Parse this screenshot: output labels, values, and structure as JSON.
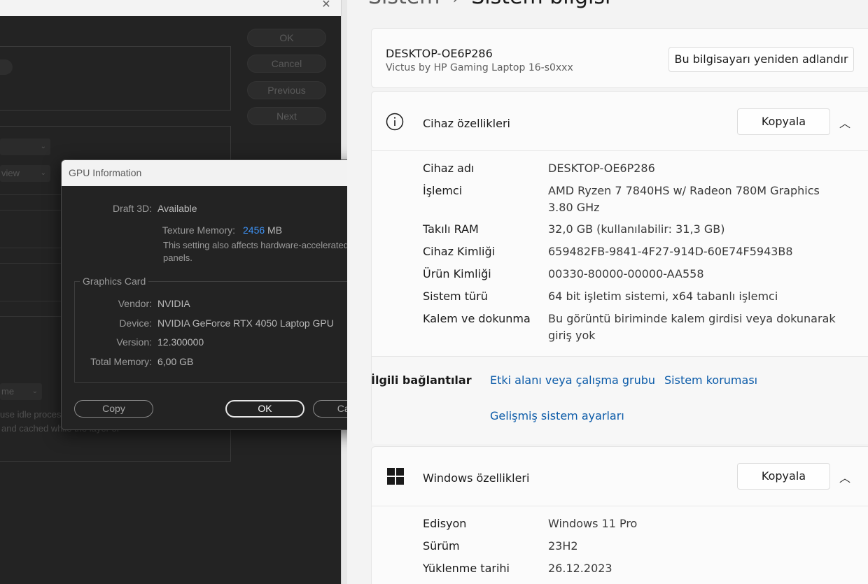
{
  "left_app": {
    "buttons": [
      {
        "label": "OK"
      },
      {
        "label": "Cancel"
      },
      {
        "label": "Previous"
      },
      {
        "label": "Next"
      }
    ],
    "partial_texts": {
      "select_view": "view",
      "select_name": "me",
      "idle_line1": "use idle proces",
      "idle_line2": "and cached while the layer or"
    }
  },
  "gpu_dialog": {
    "title": "GPU Information",
    "draft3d_label": "Draft 3D:",
    "draft3d_value": "Available",
    "texture_label": "Texture Memory:",
    "texture_value": "2456",
    "texture_unit": "MB",
    "note": "This setting also affects hardware-accelerated panels.",
    "graphics_card": {
      "legend": "Graphics Card",
      "vendor_label": "Vendor:",
      "vendor_value": "NVIDIA",
      "device_label": "Device:",
      "device_value": "NVIDIA GeForce RTX 4050 Laptop GPU",
      "version_label": "Version:",
      "version_value": "12.300000",
      "total_label": "Total Memory:",
      "total_value": "6,00 GB"
    },
    "buttons": {
      "copy": "Copy",
      "ok": "OK",
      "cancel": "Cancel"
    }
  },
  "settings": {
    "breadcrumb": {
      "parent": "Sistem",
      "separator": "›",
      "current": "Sistem bilgisi"
    },
    "device": {
      "name": "DESKTOP-OE6P286",
      "model": "Victus by HP Gaming Laptop 16-s0xxx",
      "rename_button": "Bu bilgisayarı yeniden adlandır"
    },
    "device_specs": {
      "title": "Cihaz özellikleri",
      "copy_button": "Kopyala",
      "rows": [
        {
          "label": "Cihaz adı",
          "value": "DESKTOP-OE6P286"
        },
        {
          "label": "İşlemci",
          "value": "AMD Ryzen 7 7840HS w/ Radeon 780M Graphics 3.80 GHz"
        },
        {
          "label": "Takılı RAM",
          "value": "32,0 GB (kullanılabilir: 31,3 GB)"
        },
        {
          "label": "Cihaz Kimliği",
          "value": "659482FB-9841-4F27-914D-60E74F5943B8"
        },
        {
          "label": "Ürün Kimliği",
          "value": "00330-80000-00000-AA558"
        },
        {
          "label": "Sistem türü",
          "value": "64 bit işletim sistemi, x64 tabanlı işlemci"
        },
        {
          "label": "Kalem ve dokunma",
          "value": "Bu görüntü biriminde kalem girdisi veya dokunarak giriş yok"
        }
      ]
    },
    "related_links": {
      "title": "İlgili bağlantılar",
      "links": [
        "Etki alanı veya çalışma grubu",
        "Sistem koruması",
        "Gelişmiş sistem ayarları"
      ]
    },
    "windows_specs": {
      "title": "Windows özellikleri",
      "copy_button": "Kopyala",
      "rows": [
        {
          "label": "Edisyon",
          "value": "Windows 11 Pro"
        },
        {
          "label": "Sürüm",
          "value": "23H2"
        },
        {
          "label": "Yüklenme tarihi",
          "value": "26.12.2023"
        }
      ]
    }
  }
}
